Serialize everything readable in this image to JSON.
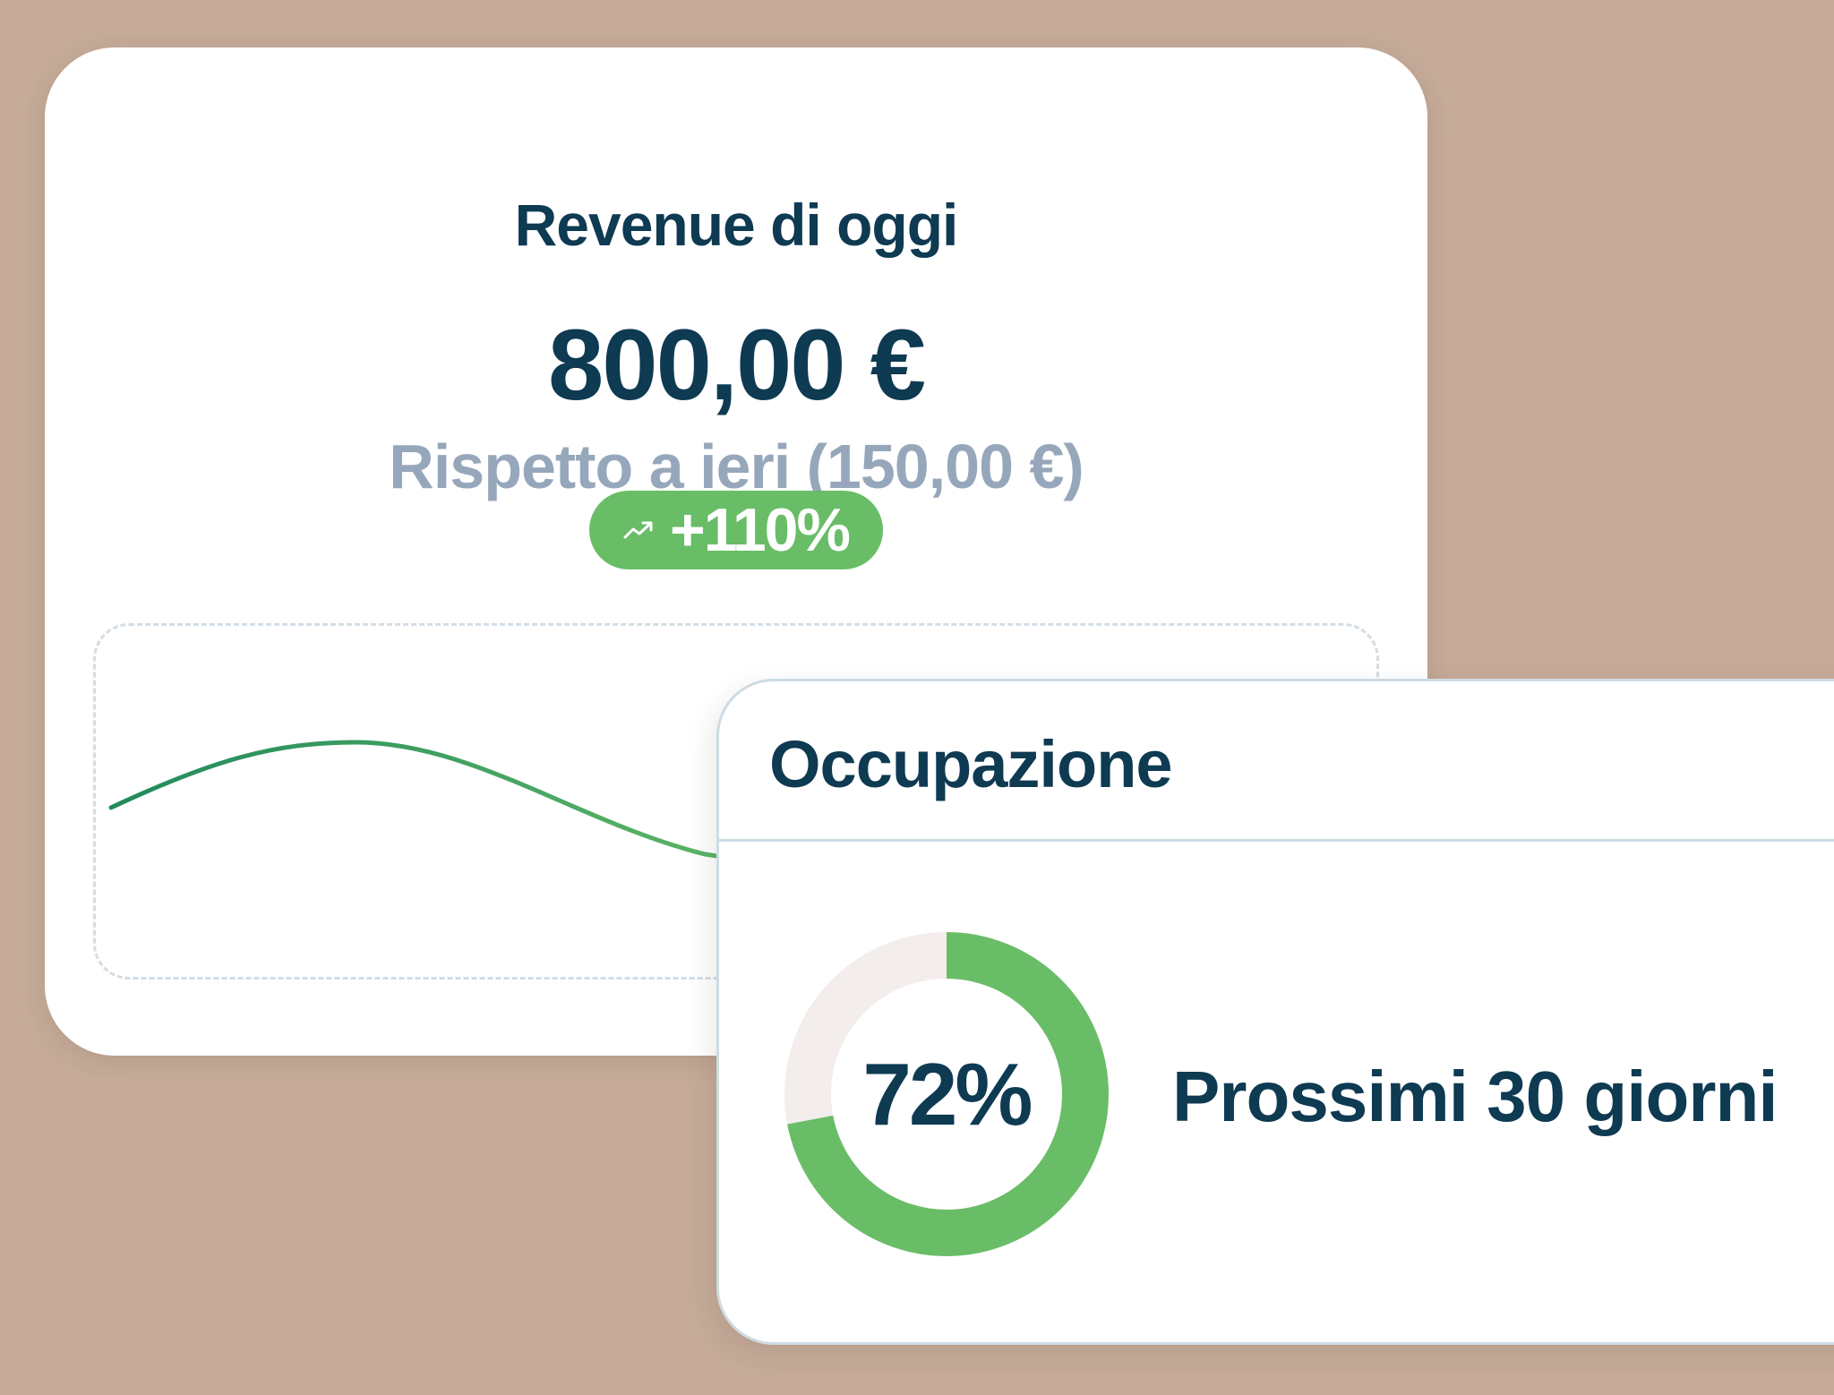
{
  "colors": {
    "background": "#c6ab99",
    "text_primary": "#0e3a52",
    "text_muted": "#97a7bb",
    "accent_green": "#69bd67",
    "line_dark_green": "#218a5c",
    "donut_track": "#f3eeeb",
    "border": "#cfdbe3"
  },
  "revenue_card": {
    "title": "Revenue di oggi",
    "amount": "800,00 €",
    "comparison": "Rispetto a ieri (150,00 €)",
    "badge": {
      "icon": "trending-up-icon",
      "label": "+110%"
    }
  },
  "occupancy_card": {
    "title": "Occupazione",
    "donut_value": 0.72,
    "donut_label": "72%",
    "period_label": "Prossimi 30 giorni"
  }
}
